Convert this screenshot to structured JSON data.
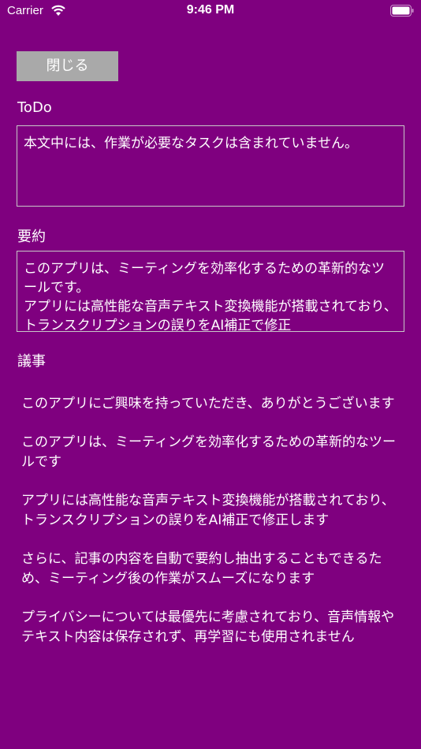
{
  "status": {
    "carrier": "Carrier",
    "time": "9:46 PM"
  },
  "close_label": "閉じる",
  "todo": {
    "label": "ToDo",
    "value": "本文中には、作業が必要なタスクは含まれていません。"
  },
  "summary": {
    "label": "要約",
    "value": "このアプリは、ミーティングを効率化するための革新的なツールです。\nアプリには高性能な音声テキスト変換機能が搭載されており、トランスクリプションの誤りをAI補正で修正"
  },
  "minutes": {
    "label": "議事",
    "items": [
      "このアプリにご興味を持っていただき、ありがとうございます",
      "このアプリは、ミーティングを効率化するための革新的なツールです",
      "アプリには高性能な音声テキスト変換機能が搭載されており、トランスクリプションの誤りをAI補正で修正します",
      "さらに、記事の内容を自動で要約し抽出することもできるため、ミーティング後の作業がスムーズになります",
      "プライバシーについては最優先に考慮されており、音声情報やテキスト内容は保存されず、再学習にも使用されません"
    ]
  }
}
